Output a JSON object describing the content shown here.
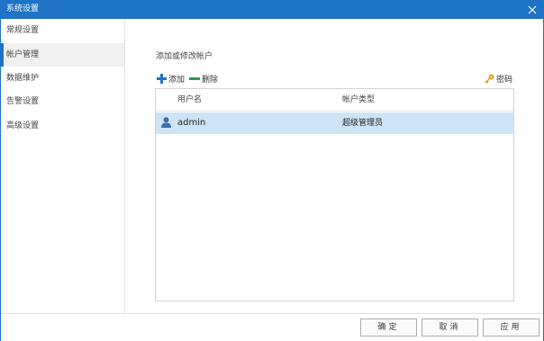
{
  "window": {
    "title": "系统设置"
  },
  "sidebar": {
    "items": [
      {
        "label": "常规设置"
      },
      {
        "label": "帐户管理"
      },
      {
        "label": "数据维护"
      },
      {
        "label": "告警设置"
      },
      {
        "label": "高级设置"
      }
    ]
  },
  "main": {
    "section_title": "添加或修改帐户",
    "toolbar": {
      "add_label": "添加",
      "delete_label": "删除",
      "password_label": "密码"
    },
    "table": {
      "columns": [
        "用户名",
        "帐户类型"
      ],
      "rows": [
        {
          "username": "admin",
          "account_type": "超级管理员"
        }
      ]
    }
  },
  "footer": {
    "ok_label": "确定",
    "cancel_label": "取消",
    "apply_label": "应用"
  },
  "colors": {
    "accent": "#1e73c6",
    "selected_row": "#cfe3f6",
    "add_icon": "#1e73c6",
    "delete_icon": "#2e9a5b",
    "key_icon": "#d9a01e"
  }
}
